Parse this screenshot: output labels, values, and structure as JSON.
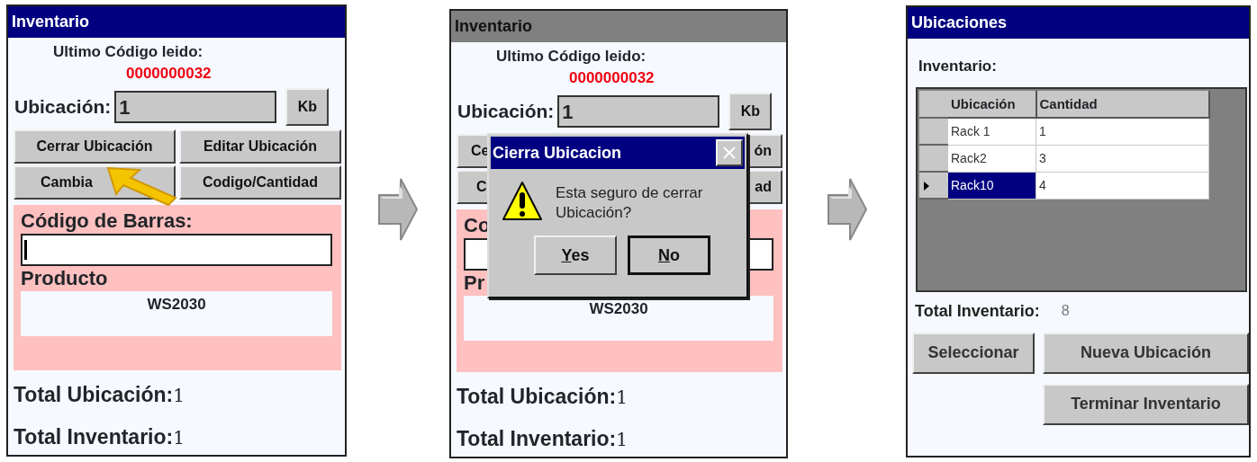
{
  "screens": [
    {
      "kind": "form",
      "title": "Inventario",
      "title_active": true,
      "last_code_label": "Ultimo Código leido:",
      "last_code": "0000000032",
      "location_label": "Ubicación:",
      "location_value": "1",
      "keyboard_button": "Kb",
      "buttons": [
        "Cerrar Ubicación",
        "Editar Ubicación",
        "Cambia",
        "Codigo/Cantidad"
      ],
      "barcode_label": "Código de Barras:",
      "barcode_caret": true,
      "product_label": "Producto",
      "product_value": "WS2030",
      "totals": [
        {
          "label": "Total Ubicación:",
          "value": "1"
        },
        {
          "label": "Total Inventario:",
          "value": "1"
        }
      ],
      "pointer": true
    },
    {
      "kind": "form",
      "title": "Inventario",
      "title_active": false,
      "last_code_label": "Ultimo Código leido:",
      "last_code": "0000000032",
      "location_label": "Ubicación:",
      "location_value": "1",
      "keyboard_button": "Kb",
      "buttons": [
        "Ce",
        "ón",
        "C",
        "ad"
      ],
      "barcode_label": "Co",
      "product_label": "Pr",
      "product_value": "WS2030",
      "totals": [
        {
          "label": "Total Ubicación:",
          "value": "1"
        },
        {
          "label": "Total Inventario:",
          "value": "1"
        }
      ],
      "dialog": {
        "title": "Cierra Ubicacion",
        "message": "Esta seguro de cerrar Ubicación?",
        "buttons": [
          {
            "label": "Yes",
            "focused": false
          },
          {
            "label": "No",
            "focused": true
          }
        ]
      }
    },
    {
      "kind": "list",
      "title": "Ubicaciones",
      "inventory_label": "Inventario:",
      "table": {
        "columns": [
          "Ubicación",
          "Cantidad"
        ],
        "rows": [
          {
            "cells": [
              "Rack 1",
              "1"
            ],
            "selected": false
          },
          {
            "cells": [
              "Rack2",
              "3"
            ],
            "selected": false
          },
          {
            "cells": [
              "Rack10",
              "4"
            ],
            "selected": true
          }
        ]
      },
      "total_label": "Total Inventario:",
      "total_value": "8",
      "buttons": [
        "Seleccionar",
        "Nueva Ubicación",
        "Terminar Inventario"
      ]
    }
  ]
}
